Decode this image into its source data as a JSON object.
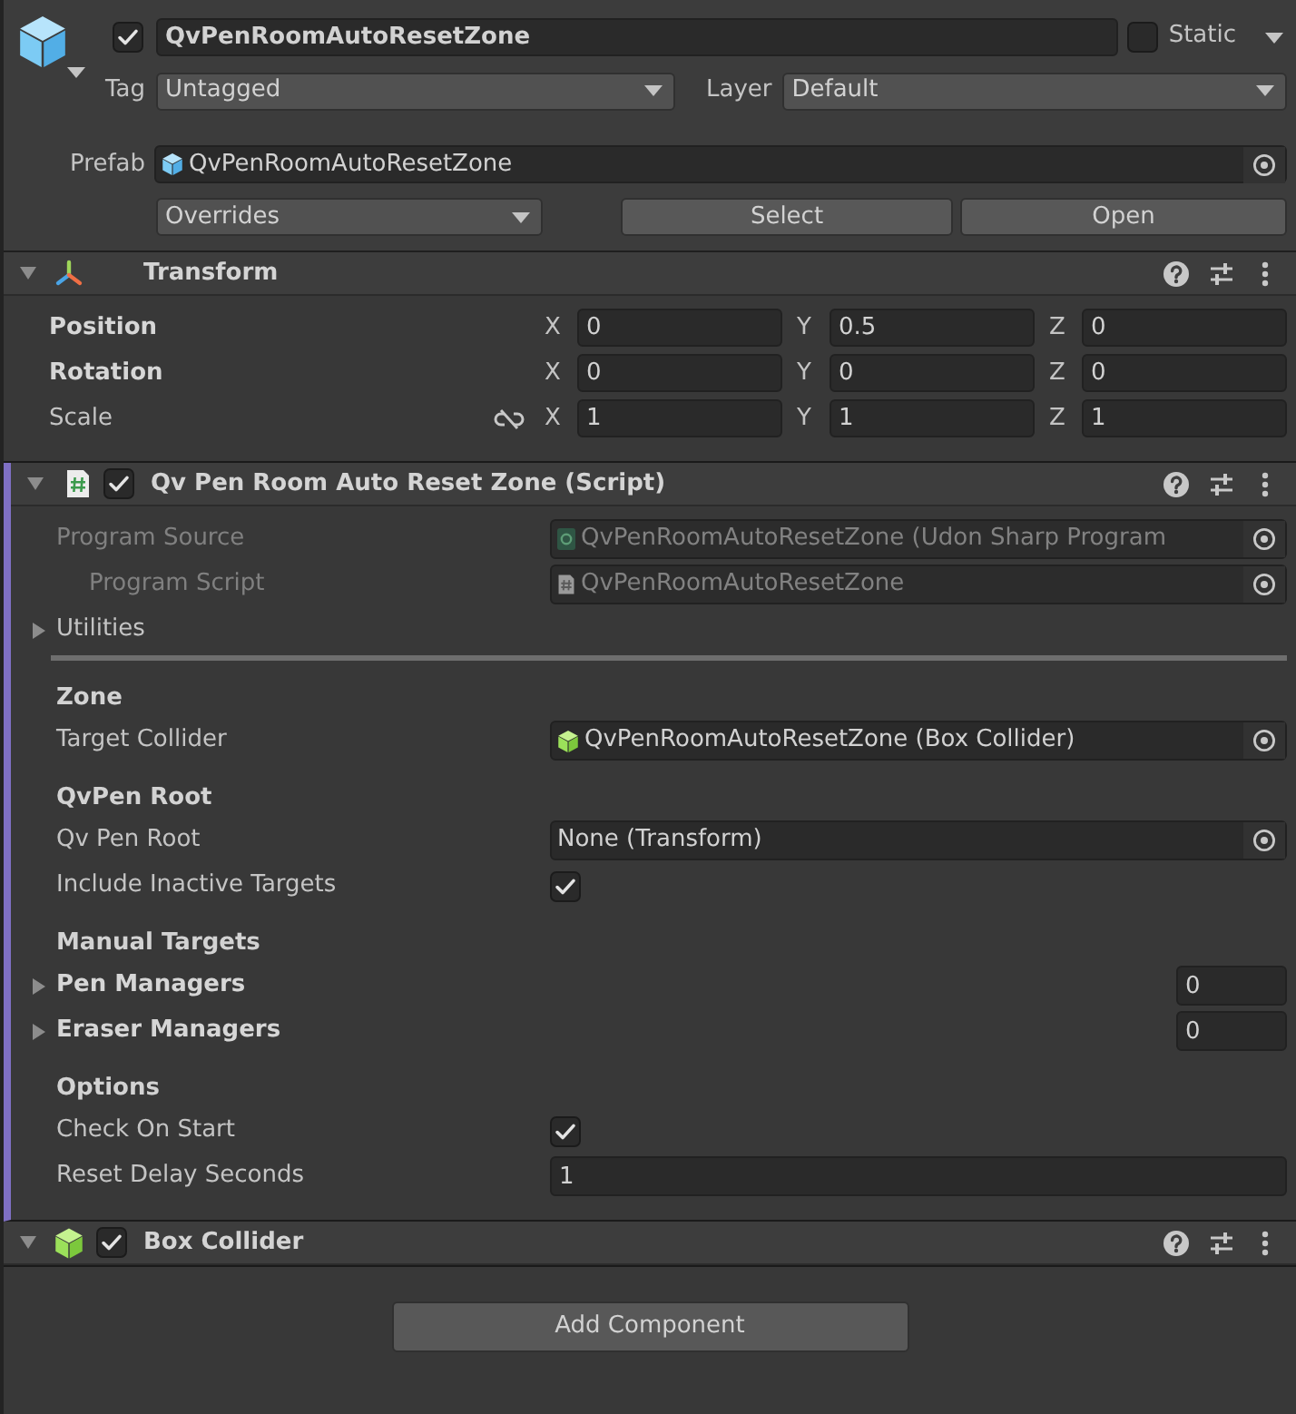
{
  "game_object": {
    "active": true,
    "name": "QvPenRoomAutoResetZone",
    "static": false,
    "static_label": "Static",
    "tag_label": "Tag",
    "tag": "Untagged",
    "layer_label": "Layer",
    "layer": "Default"
  },
  "prefab": {
    "label": "Prefab",
    "asset": "QvPenRoomAutoResetZone",
    "overrides": "Overrides",
    "buttons": [
      "Select",
      "Open"
    ]
  },
  "components": [
    {
      "kind": "transform",
      "title": "Transform",
      "expanded": true,
      "added": false,
      "rows": [
        {
          "label": "Position",
          "overridden": true,
          "axes": [
            {
              "axis": "X",
              "value": "0"
            },
            {
              "axis": "Y",
              "value": "0.5"
            },
            {
              "axis": "Z",
              "value": "0"
            }
          ]
        },
        {
          "label": "Rotation",
          "overridden": true,
          "axes": [
            {
              "axis": "X",
              "value": "0"
            },
            {
              "axis": "Y",
              "value": "0"
            },
            {
              "axis": "Z",
              "value": "0"
            }
          ]
        },
        {
          "label": "Scale",
          "overridden": false,
          "proportions_linked": false,
          "axes": [
            {
              "axis": "X",
              "value": "1"
            },
            {
              "axis": "Y",
              "value": "1"
            },
            {
              "axis": "Z",
              "value": "1"
            }
          ]
        }
      ]
    },
    {
      "kind": "script",
      "title": "Qv Pen Room Auto Reset Zone (Script)",
      "enabled": true,
      "expanded": true,
      "added": true,
      "fields": [
        {
          "kind": "object",
          "label": "Program Source",
          "reference": {
            "kind": "program_asset",
            "text": "QvPenRoomAutoResetZone (Udon Sharp Program"
          },
          "disabled": true,
          "overridden": false,
          "children": [
            {
              "kind": "object",
              "label": "Program Script",
              "reference": {
                "kind": "script",
                "text": "QvPenRoomAutoResetZone"
              },
              "disabled": true,
              "overridden": false
            }
          ]
        },
        {
          "kind": "foldout",
          "label": "Utilities",
          "expanded": false
        },
        {
          "kind": "separator"
        },
        {
          "kind": "header",
          "label": "Zone"
        },
        {
          "kind": "object",
          "label": "Target Collider",
          "reference": {
            "kind": "collider",
            "text": "QvPenRoomAutoResetZone (Box Collider)"
          },
          "disabled": false,
          "overridden": false
        },
        {
          "kind": "header",
          "label": "QvPen Root"
        },
        {
          "kind": "object",
          "label": "Qv Pen Root",
          "reference": {
            "kind": "empty",
            "text": "None (Transform)"
          },
          "disabled": false,
          "overridden": false
        },
        {
          "kind": "toggle",
          "label": "Include Inactive Targets",
          "checked": true,
          "overridden": false
        },
        {
          "kind": "header",
          "label": "Manual Targets"
        },
        {
          "kind": "array",
          "label": "Pen Managers",
          "size": "0",
          "expanded": false,
          "overridden": true
        },
        {
          "kind": "array",
          "label": "Eraser Managers",
          "size": "0",
          "expanded": false,
          "overridden": true
        },
        {
          "kind": "header",
          "label": "Options"
        },
        {
          "kind": "toggle",
          "label": "Check On Start",
          "checked": true,
          "overridden": false
        },
        {
          "kind": "number",
          "label": "Reset Delay Seconds",
          "value": "1",
          "overridden": false
        }
      ]
    },
    {
      "kind": "box_collider",
      "title": "Box Collider",
      "enabled": true,
      "expanded": true,
      "added": false
    }
  ],
  "add_component": "Add Component"
}
